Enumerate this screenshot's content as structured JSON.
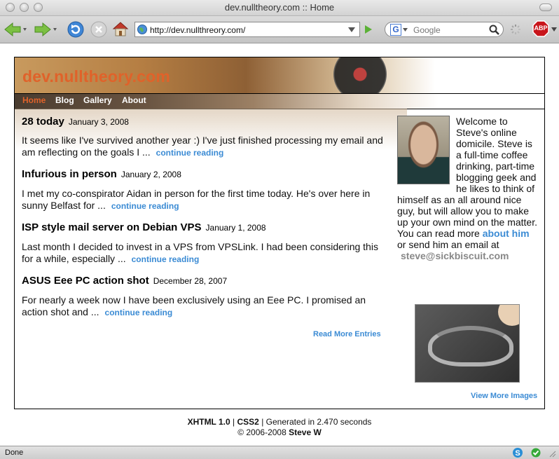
{
  "window": {
    "title": "dev.nulltheory.com :: Home"
  },
  "toolbar": {
    "url": "http://dev.nullthreory.com/",
    "search_placeholder": "Google",
    "search_engine_letter": "G",
    "adblock_label": "ABP"
  },
  "site": {
    "title": "dev.nulltheory.com",
    "nav": [
      "Home",
      "Blog",
      "Gallery",
      "About"
    ],
    "entries": [
      {
        "title": "28 today",
        "date": "January 3, 2008",
        "excerpt": "It seems like I've survived another year :) I've just finished processing my email and am reflecting on the goals I ...",
        "link": "continue reading"
      },
      {
        "title": "Infurious in person",
        "date": "January 2, 2008",
        "excerpt": "I met my co-conspirator Aidan in person for the first time today. He's over here in sunny Belfast for ...",
        "link": "continue reading"
      },
      {
        "title": "ISP style mail server on Debian VPS",
        "date": "January 1, 2008",
        "excerpt": "Last month I decided to invest in a VPS from VPSLink. I had been considering this for a while, especially ...",
        "link": "continue reading"
      },
      {
        "title": "ASUS Eee PC action shot",
        "date": "December 28, 2007",
        "excerpt": "For nearly a week now I have been exclusively using an Eee PC. I promised an action shot and ...",
        "link": "continue reading"
      }
    ],
    "read_more": "Read More Entries",
    "bio": {
      "intro": "Welcome to Steve's online domicile. Steve is a full-time coffee drinking, part-time blogging geek and he likes to think of himself as an all around nice guy, but will allow you to make up your own mind on the matter. You can read more",
      "about_link": "about him",
      "mid": "or send him an email at",
      "email": "steve@sickbiscuit.com"
    },
    "view_more_images": "View More Images"
  },
  "footer": {
    "xhtml": "XHTML 1.0",
    "sep1": "|",
    "css": "CSS2",
    "generated": "| Generated in 2.470 seconds",
    "copyright": "© 2006-2008",
    "author": "Steve W"
  },
  "statusbar": {
    "text": "Done"
  }
}
